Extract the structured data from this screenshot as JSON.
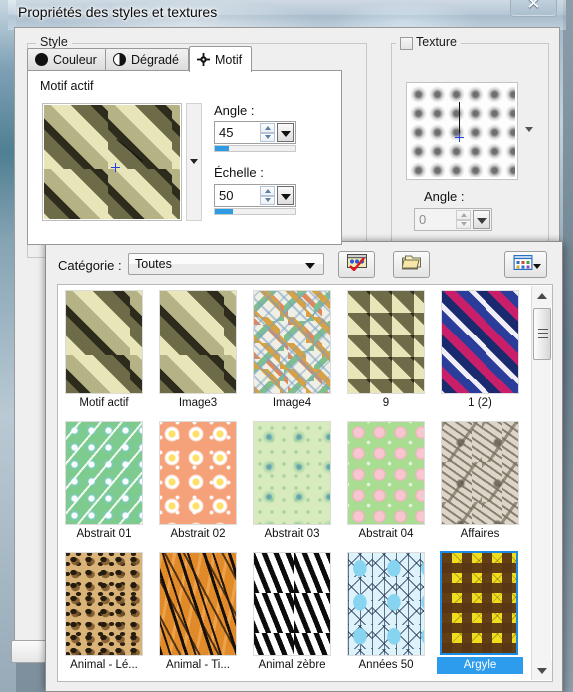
{
  "window": {
    "title": "Propriétés des styles et textures",
    "close_label": "✕"
  },
  "style_group": {
    "label": "Style",
    "tabs": [
      {
        "label": "Couleur",
        "icon": "solid-circle-icon",
        "active": false
      },
      {
        "label": "Dégradé",
        "icon": "half-circle-icon",
        "active": false
      },
      {
        "label": "Motif",
        "icon": "pattern-grid-icon",
        "active": true
      }
    ],
    "panel_title": "Motif actif",
    "angle": {
      "label": "Angle :",
      "value": "45",
      "fill_percent": 18
    },
    "scale": {
      "label": "Échelle :",
      "value": "50",
      "fill_percent": 22
    }
  },
  "texture_group": {
    "label": "Texture",
    "checked": false,
    "angle": {
      "label": "Angle :",
      "value": "0",
      "enabled": false
    }
  },
  "browser": {
    "category_label": "Catégorie :",
    "category_value": "Toutes",
    "buttons": [
      {
        "name": "edit-selection-button",
        "icon": "palette-check-icon"
      },
      {
        "name": "copy-folder-button",
        "icon": "folder-copy-icon"
      },
      {
        "name": "view-mode-button",
        "icon": "grid-view-icon",
        "has_arrow": true
      }
    ],
    "rows": [
      [
        {
          "label": "Motif actif",
          "art": "art-olive-lg",
          "selected": false
        },
        {
          "label": "Image3",
          "art": "art-olive-lg",
          "selected": false
        },
        {
          "label": "Image4",
          "art": "art-imgx",
          "selected": false
        },
        {
          "label": "9",
          "art": "art-olive-sm",
          "selected": false
        },
        {
          "label": "1 (2)",
          "art": "art-purple",
          "selected": false
        }
      ],
      [
        {
          "label": "Abstrait 01",
          "art": "art-ab01",
          "selected": false
        },
        {
          "label": "Abstrait 02",
          "art": "art-ab02",
          "selected": false
        },
        {
          "label": "Abstrait 03",
          "art": "art-ab03",
          "selected": false
        },
        {
          "label": "Abstrait 04",
          "art": "art-ab04",
          "selected": false
        },
        {
          "label": "Affaires",
          "art": "art-affaires",
          "selected": false
        }
      ],
      [
        {
          "label": "Animal - Lé...",
          "art": "art-leopard",
          "selected": false
        },
        {
          "label": "Animal - Ti...",
          "art": "art-tiger",
          "selected": false
        },
        {
          "label": "Animal zèbre",
          "art": "art-zebra",
          "selected": false
        },
        {
          "label": "Années 50",
          "art": "art-50s",
          "selected": false
        },
        {
          "label": "Argyle",
          "art": "art-argyle",
          "selected": true
        }
      ]
    ]
  },
  "colors": {
    "accent_blue": "#2e9ced",
    "slider_blue": "#2f9be4",
    "dialog_bg": "#efefef"
  }
}
